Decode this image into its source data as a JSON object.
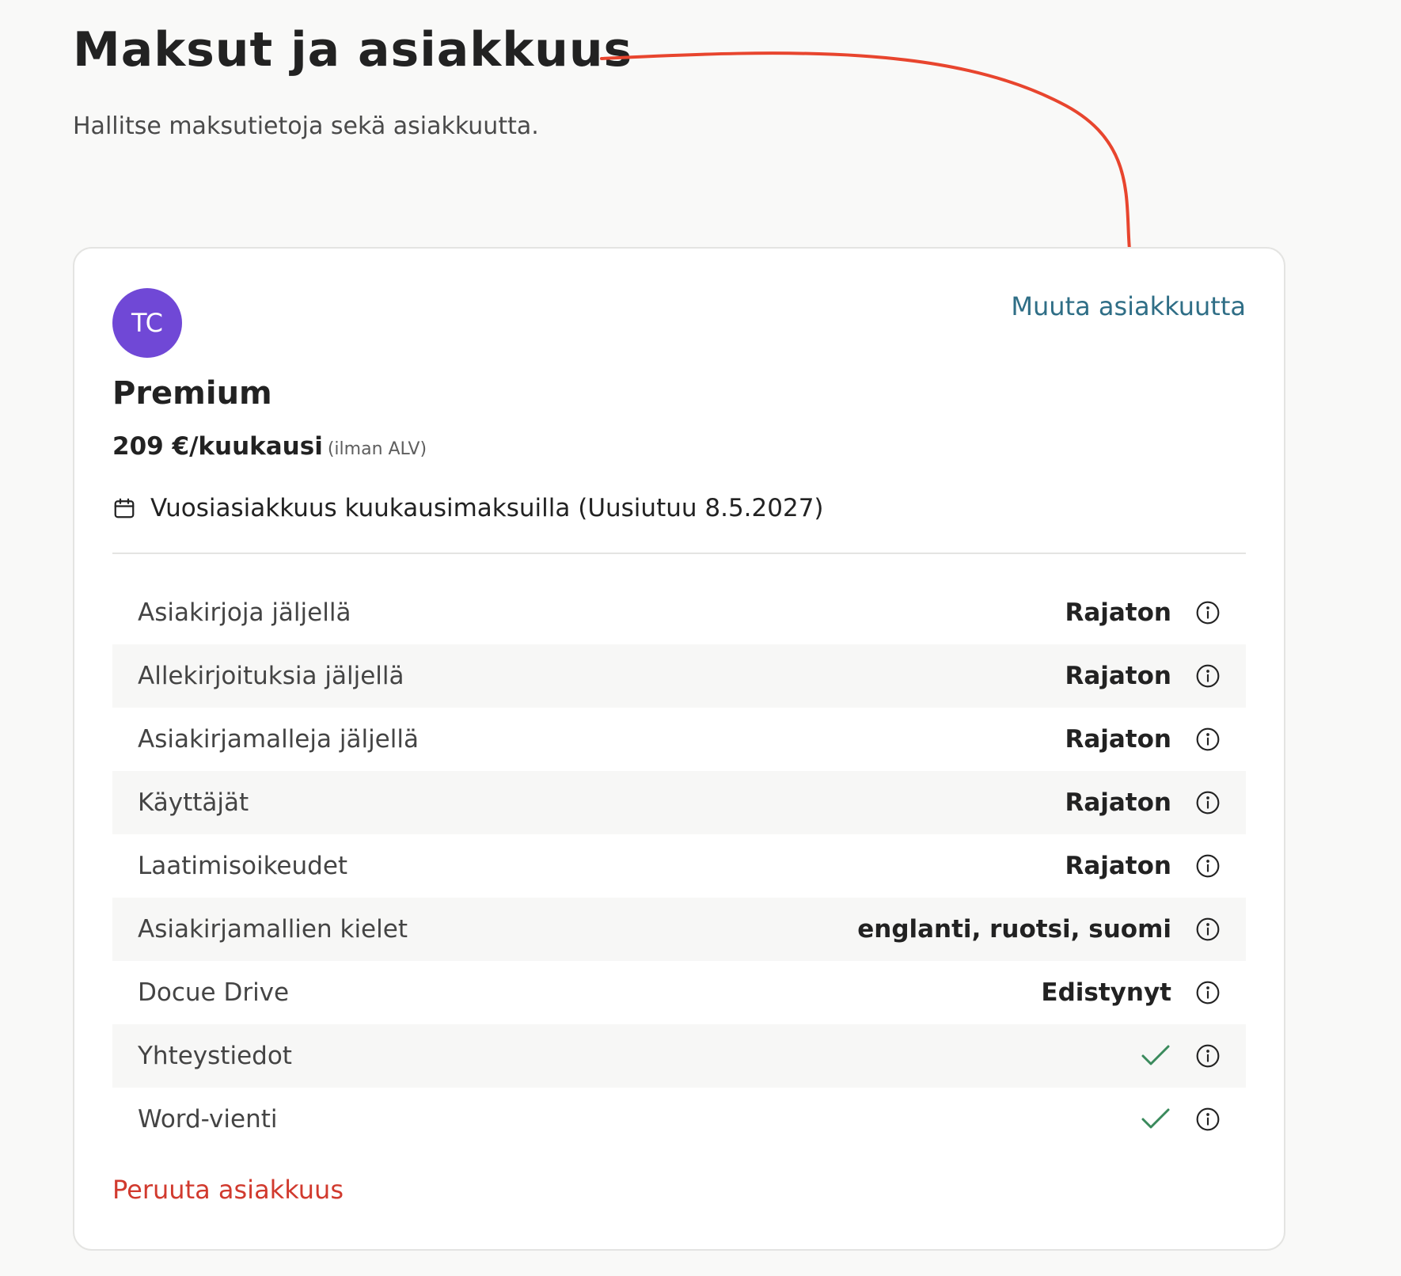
{
  "header": {
    "title": "Maksut ja asiakkuus",
    "subtitle": "Hallitse maksutietoja sekä asiakkuutta."
  },
  "plan": {
    "avatar_initials": "TC",
    "change_label": "Muuta asiakkuutta",
    "name": "Premium",
    "price": "209 €/kuukausi",
    "vat_note": "(ilman ALV)",
    "billing": "Vuosiasiakkuus kuukausimaksuilla (Uusiutuu 8.5.2027)",
    "cancel_label": "Peruuta asiakkuus"
  },
  "features": [
    {
      "label": "Asiakirjoja jäljellä",
      "value": "Rajaton"
    },
    {
      "label": "Allekirjoituksia jäljellä",
      "value": "Rajaton"
    },
    {
      "label": "Asiakirjamalleja jäljellä",
      "value": "Rajaton"
    },
    {
      "label": "Käyttäjät",
      "value": "Rajaton"
    },
    {
      "label": "Laatimisoikeudet",
      "value": "Rajaton"
    },
    {
      "label": "Asiakirjamallien kielet",
      "value": "englanti, ruotsi, suomi"
    },
    {
      "label": "Docue Drive",
      "value": "Edistynyt"
    },
    {
      "label": "Yhteystiedot",
      "value": "check"
    },
    {
      "label": "Word-vienti",
      "value": "check"
    }
  ],
  "icons": {
    "calendar": "calendar-icon",
    "info": "info-icon",
    "check": "check-icon",
    "arrow": "annotation-arrow"
  },
  "colors": {
    "avatar": "#7048d6",
    "link": "#2f6e86",
    "danger": "#d13a2e",
    "check": "#3a8a5c",
    "arrow": "#e8452e"
  }
}
